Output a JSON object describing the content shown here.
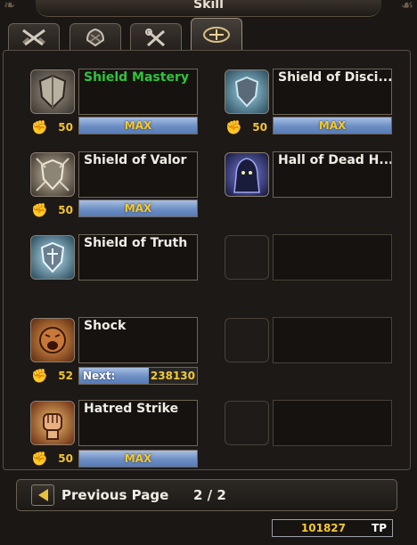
{
  "window": {
    "title": "Skill"
  },
  "tabs": [
    {
      "name": "tab-weapons",
      "icon": "crossed-swords-icon"
    },
    {
      "name": "tab-armor",
      "icon": "armor-icon"
    },
    {
      "name": "tab-tools",
      "icon": "tools-icon"
    },
    {
      "name": "tab-special",
      "icon": "emblem-icon",
      "active": true
    }
  ],
  "skills": [
    {
      "name": "Shield Mastery",
      "level": "50",
      "bar": "MAX",
      "highlight": true
    },
    {
      "name": "Shield of Disci...",
      "level": "50",
      "bar": "MAX"
    },
    {
      "name": "Shield of Valor",
      "level": "50",
      "bar": "MAX"
    },
    {
      "name": "Hall of Dead H..."
    },
    {
      "name": "Shield of Truth"
    },
    {
      "name": "Shock",
      "level": "52",
      "next_label": "Next:",
      "next_value": "238130"
    },
    {
      "name": "Hatred Strike",
      "level": "50",
      "bar": "MAX"
    }
  ],
  "pagination": {
    "prev_label": "Previous Page",
    "page": "2 / 2"
  },
  "tp": {
    "value": "101827",
    "unit": "TP"
  },
  "colors": {
    "max_text": "#f6c92f",
    "level_text": "#f4c430",
    "highlight_name": "#2ec53a",
    "bar": "#6d8ec4"
  }
}
